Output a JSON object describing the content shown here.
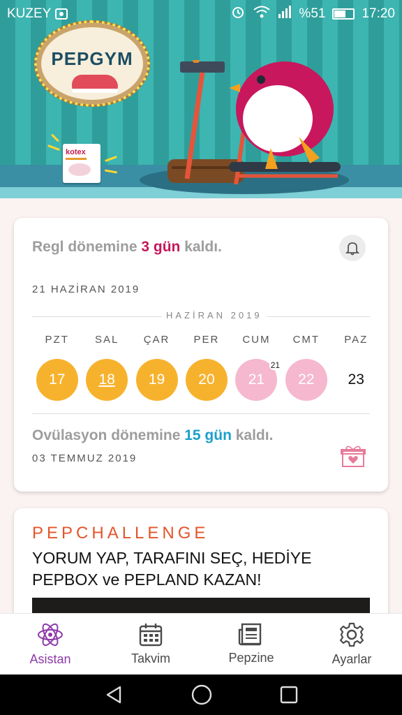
{
  "status_bar": {
    "carrier": "KUZEY",
    "battery": "%51",
    "time": "17:20"
  },
  "banner": {
    "sign_text": "PEPGYM",
    "box_brand": "kotex"
  },
  "period_card": {
    "prefix": "Regl dönemine ",
    "days": "3 gün",
    "suffix": " kaldı.",
    "date": "21 HAZİRAN 2019",
    "month_label": "HAZİRAN 2019",
    "week": [
      {
        "name": "PZT",
        "num": "17",
        "state": "past"
      },
      {
        "name": "SAL",
        "num": "18",
        "state": "past-today"
      },
      {
        "name": "ÇAR",
        "num": "19",
        "state": "past"
      },
      {
        "name": "PER",
        "num": "20",
        "state": "past"
      },
      {
        "name": "CUM",
        "num": "21",
        "state": "period",
        "badge": "21"
      },
      {
        "name": "CMT",
        "num": "22",
        "state": "period"
      },
      {
        "name": "PAZ",
        "num": "23",
        "state": "plain"
      }
    ],
    "ovulation_prefix": "Ovülasyon dönemine ",
    "ovulation_days": "15 gün",
    "ovulation_suffix": " kaldı.",
    "ovulation_date": "03 TEMMUZ 2019"
  },
  "challenge_card": {
    "title": "PEPCHALLENGE",
    "text": "YORUM YAP, TARAFINI SEÇ, HEDİYE PEPBOX ve PEPLAND KAZAN!"
  },
  "bottom_nav": {
    "items": [
      {
        "label": "Asistan",
        "icon": "atom-icon",
        "active": true
      },
      {
        "label": "Takvim",
        "icon": "calendar-icon"
      },
      {
        "label": "Pepzine",
        "icon": "newspaper-icon"
      },
      {
        "label": "Ayarlar",
        "icon": "gear-icon"
      }
    ]
  },
  "colors": {
    "period_accent": "#c3185b",
    "ovulation_accent": "#1aa0c9",
    "past_day": "#f7b22d",
    "period_day": "#f5b8cf",
    "nav_active": "#8e3aa8",
    "challenge_title": "#e4552a"
  }
}
